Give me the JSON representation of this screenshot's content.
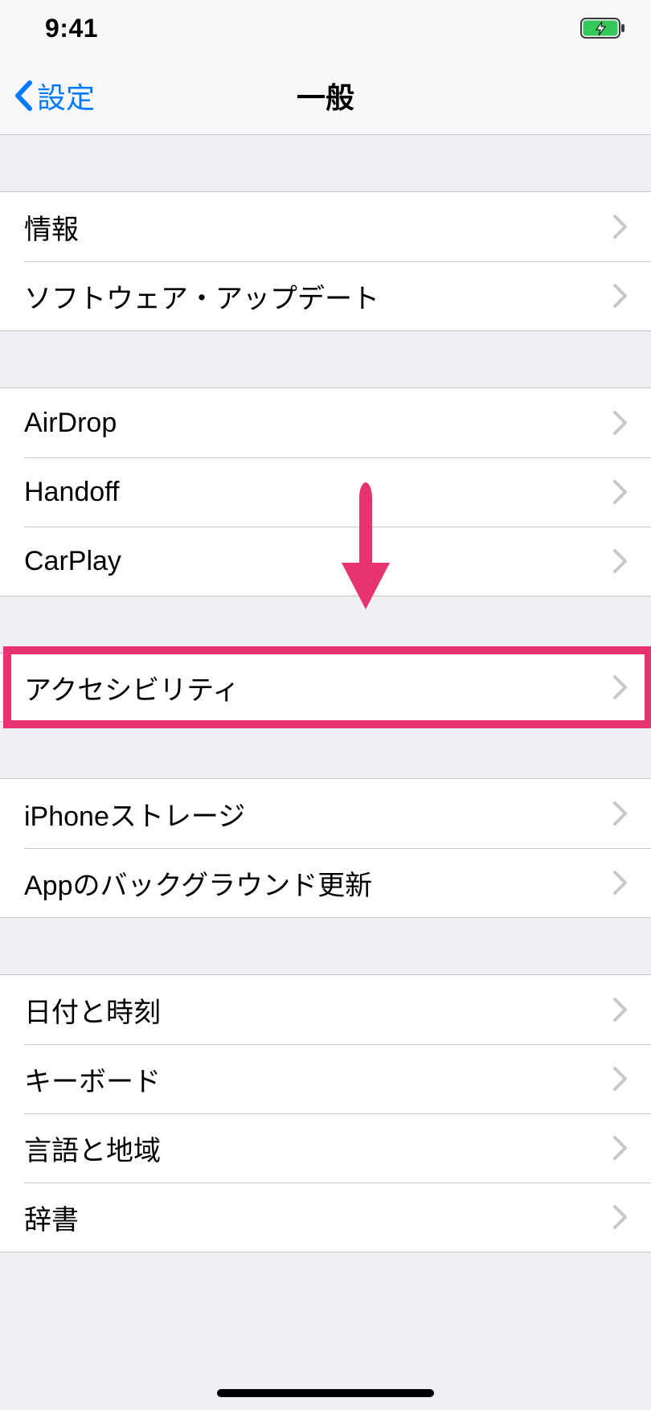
{
  "status": {
    "time": "9:41",
    "battery_icon": "battery-charging-icon"
  },
  "nav": {
    "back_label": "設定",
    "title": "一般"
  },
  "groups": [
    {
      "items": [
        {
          "key": "about",
          "label": "情報"
        },
        {
          "key": "software-update",
          "label": "ソフトウェア・アップデート"
        }
      ]
    },
    {
      "items": [
        {
          "key": "airdrop",
          "label": "AirDrop"
        },
        {
          "key": "handoff",
          "label": "Handoff"
        },
        {
          "key": "carplay",
          "label": "CarPlay"
        }
      ]
    },
    {
      "items": [
        {
          "key": "accessibility",
          "label": "アクセシビリティ",
          "highlighted": true
        }
      ]
    },
    {
      "items": [
        {
          "key": "iphone-storage",
          "label": "iPhoneストレージ"
        },
        {
          "key": "background-app-refresh",
          "label": "Appのバックグラウンド更新"
        }
      ]
    },
    {
      "items": [
        {
          "key": "date-time",
          "label": "日付と時刻"
        },
        {
          "key": "keyboard",
          "label": "キーボード"
        },
        {
          "key": "language-region",
          "label": "言語と地域"
        },
        {
          "key": "dictionary",
          "label": "辞書"
        }
      ]
    }
  ],
  "annotation": {
    "arrow_color": "#e73371",
    "highlight_color": "#e73371"
  }
}
